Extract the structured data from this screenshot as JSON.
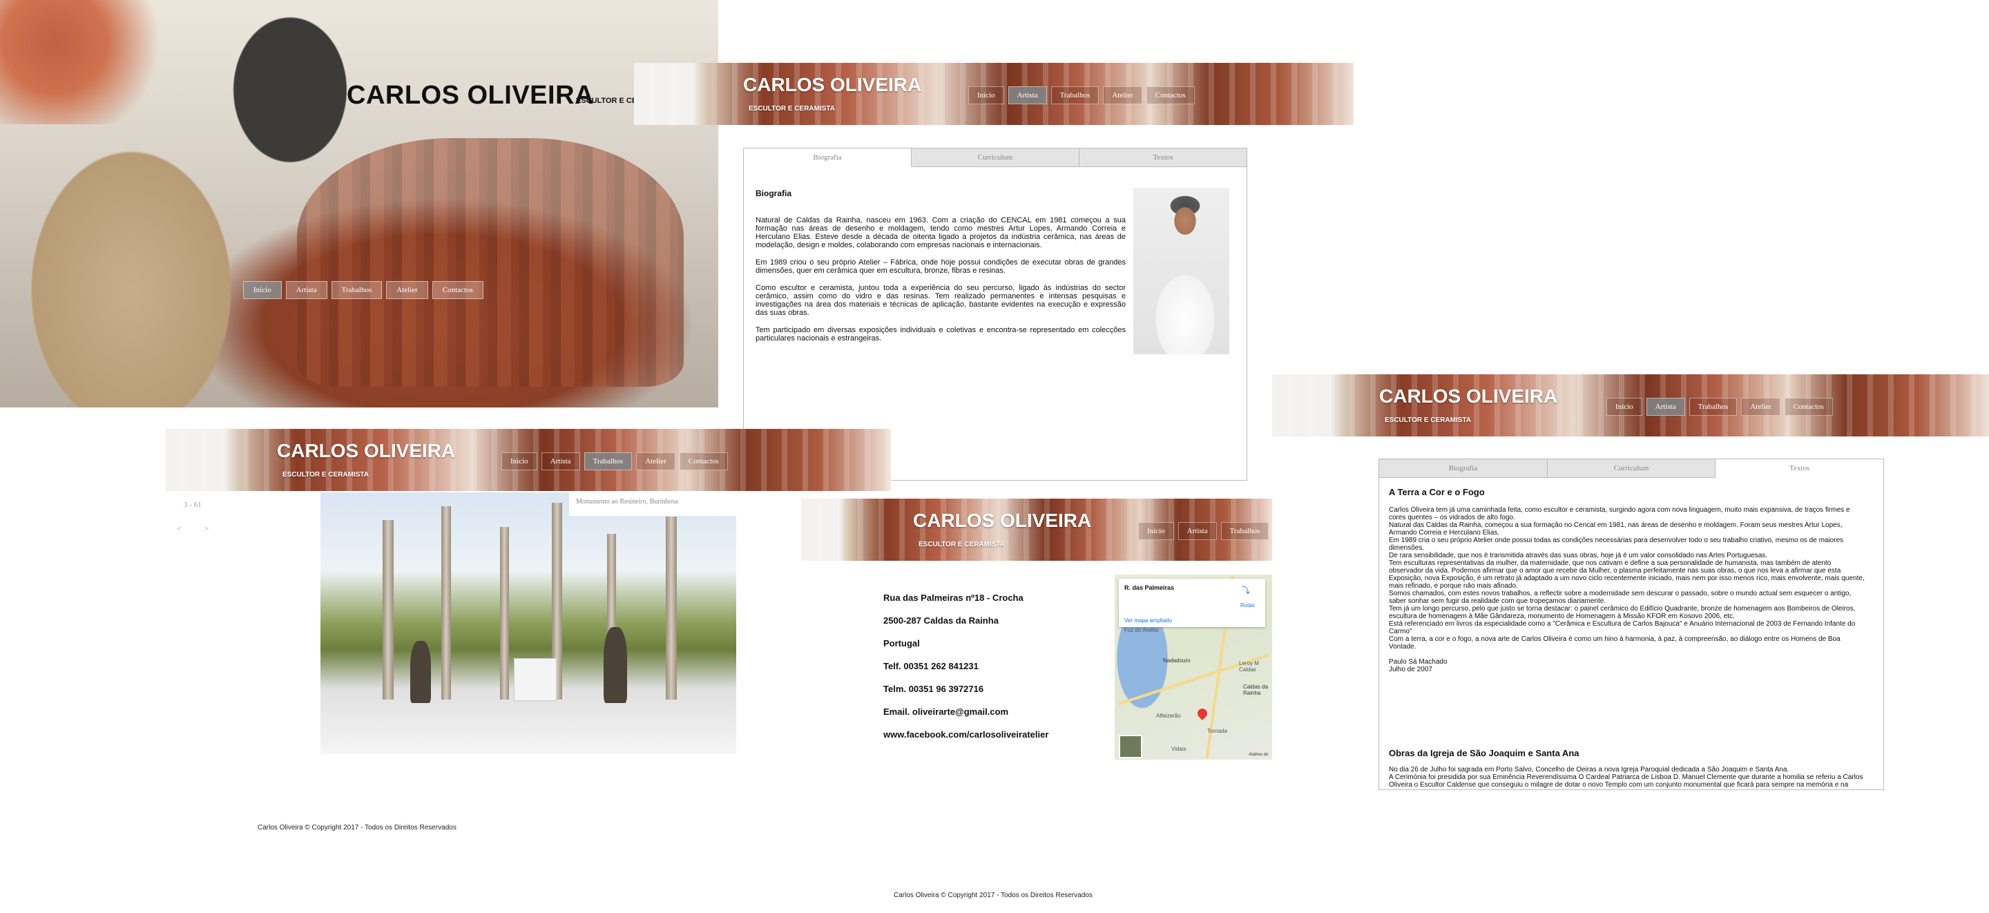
{
  "hero": {
    "title": "CARLOS OLIVEIRA",
    "subtitle": "ESCULTOR E CER",
    "nav": [
      "Início",
      "Artista",
      "Trabalhos",
      "Atelier",
      "Contactos"
    ],
    "active_nav": "Início"
  },
  "site": {
    "title": "CARLOS OLIVEIRA",
    "subtitle": "ESCULTOR E CERAMISTA",
    "nav": [
      "Início",
      "Artista",
      "Trabalhos",
      "Atelier",
      "Contactos"
    ]
  },
  "biografia_page": {
    "tabs": [
      "Biografia",
      "Curriculum",
      "Textos"
    ],
    "active_tab": "Biografia",
    "heading": "Biografia",
    "paragraphs": [
      "Natural de Caldas da Rainha, nasceu em 1963. Com a criação do CENCAL em 1981 começou a sua formação nas áreas de desenho e moldagem, tendo como mestres Artur Lopes, Armando Correia e Herculano Elias. Esteve desde a década de oitenta ligado a projetos da indústria cerâmica, nas áreas de modelação, design e moldes, colaborando com empresas nacionais e internacionais.",
      "Em 1989 criou o seu próprio Atelier – Fábrica, onde hoje possui condições de executar obras de grandes dimensões, quer em cerâmica quer em escultura, bronze, fibras e resinas.",
      "Como escultor e ceramista, juntou toda a experiência do seu percurso, ligado às indústrias do sector cerâmico, assim como do vidro e das resinas. Tem realizado permanentes e intensas pesquisas e investigações na área dos materiais e técnicas de aplicação, bastante evidentes na execução e expressão das suas obras.",
      "Tem participado em diversas exposições individuais e coletivas e encontra-se representado em colecções particulares nacionais e estrangeiras."
    ]
  },
  "trabalhos_page": {
    "counter": "3 - 61",
    "prev": "<",
    "next": ">",
    "caption": "Monumento ao Resineiro, Burinhosa"
  },
  "contactos_page": {
    "lines": [
      "Rua das Palmeiras nº18 - Crocha",
      "2500-287 Caldas da Rainha",
      "Portugal",
      "Telf.   00351 262 841231",
      "Telm. 00351 96 3972716",
      "Email. oliveirarte@gmail.com",
      "www.facebook.com/carlosoliveiratelier"
    ],
    "map": {
      "place": "R. das Palmeiras",
      "directions": "Rotas",
      "enlarge": "Ver mapa ampliado",
      "labels": [
        "Foz do Arelho",
        "Nadadouro",
        "Leroy M Caldas",
        "Caldas da Rainha",
        "Tornada",
        "Vidais",
        "Alfeizerão"
      ],
      "credit": "Atalhos do"
    }
  },
  "textos_page": {
    "tabs": [
      "Biografia",
      "Curriculum",
      "Textos"
    ],
    "active_tab": "Textos",
    "section1_title": "A Terra a Cor e o Fogo",
    "section1_lines": [
      "Carlos Oliveira tem já uma caminhada feita, como escultor e ceramista, surgindo agora com nova linguagem, muito mais expansiva, de traços firmes e",
      "cores quentes – os vidrados de alto fogo.",
      "Natural das Caldas da Rainha, começou a sua formação no Cencal em 1981, nas áreas de desenho e moldagem. Foram seus mestres Artur Lopes,",
      "Armando Correia e Herculano Elias.",
      "Em 1989 cria o seu próprio Atelier onde possui todas as condições necessárias para desenvolver todo o seu trabalho criativo, mesmo os de maiores",
      "dimensões.",
      "De rara sensibilidade, que nos é transmitida através das suas obras, hoje já é um valor consolidado nas Artes Portuguesas.",
      "Tem esculturas representativas da mulher, da maternidade, que nos cativam e define a sua personalidade de humanista, mas também de atento",
      "observador da vida. Podemos afirmar que o amor que recebe da Mulher, o plasma perfeitamente nas suas obras, o que nos leva a afirmar que esta",
      "Exposição, nova Exposição, é um retrato já adaptado a um novo ciclo recentemente iniciado, mais nem por isso menos rico, mais envolvente, mais quente,",
      "mais refinado, e porque não mais afinado.",
      "Somos chamados, com estes novos trabalhos, a reflectir sobre a modernidade sem descurar o passado, sobre o mundo actual sem esquecer o antigo,",
      "saber sonhar sem fugir da realidade com que tropeçamos diariamente.",
      "Tem já um longo percurso, pelo que justo se torna destacar: o painel cerâmico do Edifício Quadrante, bronze de homenagem aos Bombeiros de Oleiros,",
      "escultura de homenagem à Mãe Gândareza, monumento de Homenagem à Missão KFOR  em Kosovo 2006, etc.",
      "Está referenciado em livros da especialidade como a \"Cerâmica e Escultura de Carlos Bajouca\" e Anuário Internacional de 2003 de Fernando Infante do",
      "Carmo\"",
      "Com a terra, a cor e o fogo, a nova arte de Carlos Oliveira é como um hino à harmonia, à paz, à compreensão, ao diálogo entre os Homens de Boa",
      "Vontade."
    ],
    "signature": [
      "Paulo Sá Machado",
      "Julho de 2007"
    ],
    "section2_title": "Obras da Igreja de São Joaquim e Santa Ana",
    "section2_lines": [
      "No dia 26 de Julho foi sagrada em Porto Salvo, Concelho de Oeiras a nova Igreja Paroquial dedicada a São Joaquim e Santa Ana.",
      " A Cerimónia foi presidida por sua Eminência Reverendíssima O Cardeal Patriarca de Lisboa D. Manuel Clemente que durante a homilia se referiu a Carlos",
      "Oliveira o Escultor Caldense que conseguiu o milagre de dotar o novo Templo com um conjunto monumental que ficará para sempre na memória e na"
    ]
  },
  "footer": {
    "copyright": "Carlos Oliveira © Copyright 2017 - Todos os Direitos Reservados"
  }
}
